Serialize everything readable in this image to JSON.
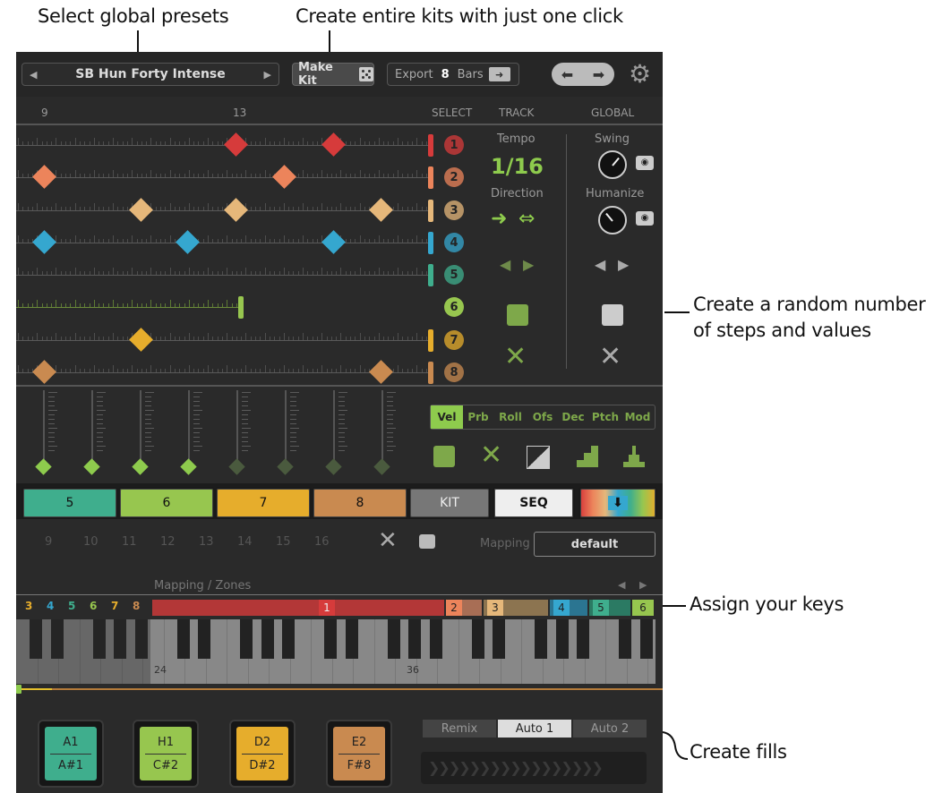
{
  "annotations": {
    "presets": "Select global presets",
    "kits": "Create entire kits with just one click",
    "random_line1": "Create a random number",
    "random_line2": "of steps and values",
    "keys": "Assign your keys",
    "fills": "Create fills"
  },
  "topbar": {
    "preset_name": "SB Hun Forty Intense",
    "make_kit": "Make Kit",
    "export_label": "Export",
    "export_bars": "8",
    "bars_label": "Bars"
  },
  "header": {
    "ruler_9": "9",
    "ruler_13": "13",
    "select": "SELECT",
    "track": "TRACK",
    "global": "GLOBAL"
  },
  "track_panel": {
    "tempo_label": "Tempo",
    "tempo_value": "1/16",
    "direction_label": "Direction"
  },
  "global_panel": {
    "swing_label": "Swing",
    "humanize_label": "Humanize"
  },
  "tracks": [
    {
      "num": "1",
      "color": "#d63b3b"
    },
    {
      "num": "2",
      "color": "#ec845b"
    },
    {
      "num": "3",
      "color": "#e5b77a"
    },
    {
      "num": "4",
      "color": "#35a7cf"
    },
    {
      "num": "5",
      "color": "#3fae8d"
    },
    {
      "num": "6",
      "color": "#97c64f"
    },
    {
      "num": "7",
      "color": "#e6ad2c"
    },
    {
      "num": "8",
      "color": "#c98a50"
    }
  ],
  "param_tabs": [
    "Vel",
    "Prb",
    "Roll",
    "Ofs",
    "Dec",
    "Ptch",
    "Mod"
  ],
  "bank_buttons": {
    "b5": "5",
    "b6": "6",
    "b7": "7",
    "b8": "8",
    "kit": "KIT",
    "seq": "SEQ"
  },
  "steps": [
    "9",
    "10",
    "11",
    "12",
    "13",
    "14",
    "15",
    "16"
  ],
  "mapping": {
    "label": "Mapping",
    "value": "default",
    "zones_label": "Mapping / Zones"
  },
  "zones": {
    "small": [
      "3",
      "4",
      "5",
      "6",
      "7",
      "8"
    ],
    "z1": "1",
    "z2": "2",
    "z3": "3",
    "z4": "4",
    "z5": "5",
    "z6": "6"
  },
  "keyboard": {
    "note_24": "24",
    "note_36": "36"
  },
  "pads": [
    {
      "top": "A1",
      "bottom": "A#1",
      "color": "#3fae8d"
    },
    {
      "top": "H1",
      "bottom": "C#2",
      "color": "#97c64f"
    },
    {
      "top": "D2",
      "bottom": "D#2",
      "color": "#e6ad2c"
    },
    {
      "top": "E2",
      "bottom": "F#8",
      "color": "#c98a50"
    }
  ],
  "fill_tabs": [
    "Remix",
    "Auto 1",
    "Auto 2"
  ],
  "icons": [
    "chevron-left-icon",
    "chevron-right-icon",
    "dice-icon",
    "export-icon",
    "undo-icon",
    "redo-icon",
    "gear-icon",
    "arrow-right-icon",
    "bidirectional-arrow-icon",
    "close-icon",
    "eye-icon",
    "knob-icon"
  ]
}
